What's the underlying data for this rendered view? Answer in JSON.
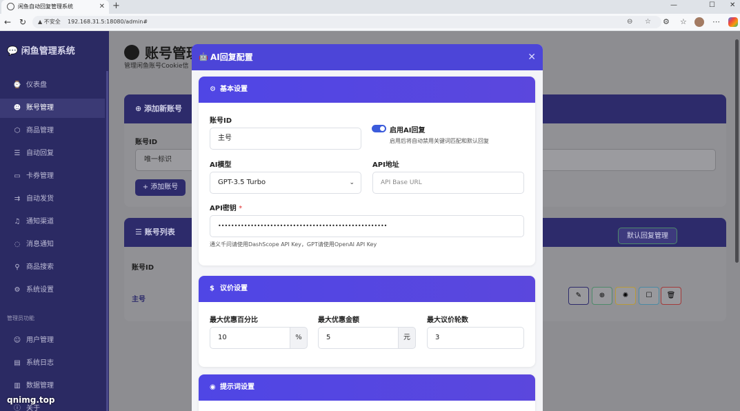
{
  "browser": {
    "tab_title": "闲鱼自动回复管理系统",
    "tab_close": "✕",
    "new_tab": "+",
    "window_controls": {
      "minimize": "—",
      "maximize": "☐",
      "close": "✕"
    },
    "nav": {
      "back": "←",
      "refresh": "↻"
    },
    "security_label": "▲ 不安全",
    "url": "192.168.31.5:18080/admin#",
    "icons": [
      "zoom-icon",
      "star-icon",
      "extensions-icon",
      "favorites-icon",
      "avatar",
      "copilot-icon"
    ]
  },
  "sidebar": {
    "brand": "💬 闲鱼管理系统",
    "items": [
      {
        "icon": "⌚",
        "label": "仪表盘"
      },
      {
        "icon": "☻",
        "label": "账号管理",
        "active": true
      },
      {
        "icon": "⬡",
        "label": "商品管理"
      },
      {
        "icon": "☰",
        "label": "自动回复"
      },
      {
        "icon": "▭",
        "label": "卡券管理"
      },
      {
        "icon": "⇉",
        "label": "自动发货"
      },
      {
        "icon": "♫",
        "label": "通知渠道"
      },
      {
        "icon": "◌",
        "label": "消息通知"
      },
      {
        "icon": "⚲",
        "label": "商品搜索"
      },
      {
        "icon": "⚙",
        "label": "系统设置"
      }
    ],
    "admin_section": "管理员功能",
    "admin_items": [
      {
        "icon": "☺",
        "label": "用户管理"
      },
      {
        "icon": "▤",
        "label": "系统日志"
      },
      {
        "icon": "▥",
        "label": "数据管理"
      }
    ],
    "about_label": "关于"
  },
  "main": {
    "title": "账号管理",
    "subtitle": "管理闲鱼账号Cookie信",
    "add_card": {
      "header": "⊕ 添加新账号",
      "label": "账号ID",
      "placeholder": "唯一标识",
      "button": "+ 添加账号"
    },
    "list_card": {
      "header": "☰ 账号列表",
      "default_reply_button": "默认回复管理",
      "col_account": "账号ID",
      "row_account": "主号"
    }
  },
  "modal": {
    "icon": "🤖",
    "title": "AI回复配置",
    "close": "✕",
    "basic": {
      "header_icon": "⚙",
      "header": "基本设置",
      "account_label": "账号ID",
      "account_value": "主号",
      "enable_label": "启用AI回复",
      "enable_help": "启用后将自动禁用关键词匹配和默认回复",
      "enabled": true,
      "model_label": "AI模型",
      "model_value": "GPT-3.5 Turbo",
      "api_url_label": "API地址",
      "api_url_placeholder": "API Base URL",
      "api_key_label": "API密钥",
      "api_key_required": "*",
      "api_key_value": "••••••••••••••••••••••••••••••••••••••••••••••••••••",
      "api_key_help": "通义千问请使用DashScope API Key，GPT请使用OpenAI API Key"
    },
    "bargain": {
      "header_icon": "$",
      "header": "议价设置",
      "max_percent_label": "最大优惠百分比",
      "max_percent_value": "10",
      "max_percent_unit": "%",
      "max_amount_label": "最大优惠金额",
      "max_amount_value": "5",
      "max_amount_unit": "元",
      "max_rounds_label": "最大议价轮数",
      "max_rounds_value": "3"
    },
    "prompt": {
      "header_icon": "◉",
      "header": "提示词设置"
    }
  },
  "watermark": "qnimg.top",
  "colors": {
    "modal_header": "#4c45d8",
    "section_header": "#4f46e5",
    "sidebar": "#2b2a63",
    "toggle_on": "#3b5bdb"
  }
}
